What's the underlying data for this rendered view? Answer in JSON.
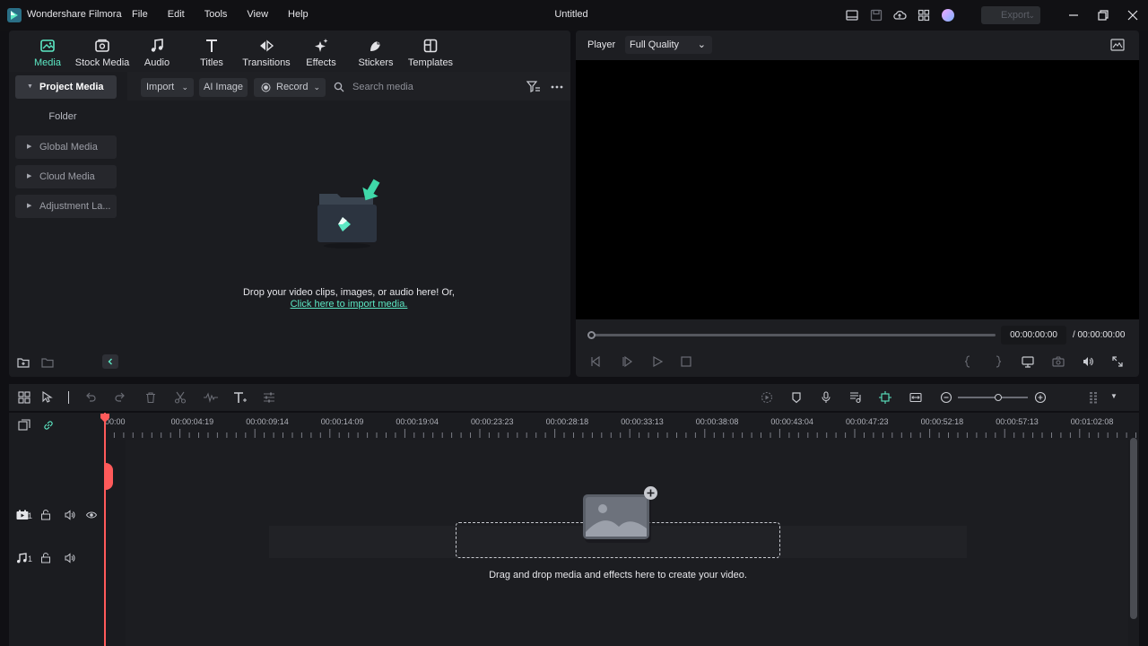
{
  "app": {
    "name": "Wondershare Filmora",
    "document_title": "Untitled",
    "menu": [
      "File",
      "Edit",
      "Tools",
      "View",
      "Help"
    ],
    "export_label": "Export",
    "accent_color": "#5ce8c4"
  },
  "media_tabs": [
    {
      "label": "Media",
      "icon": "media-icon",
      "active": true
    },
    {
      "label": "Stock Media",
      "icon": "stock-media-icon"
    },
    {
      "label": "Audio",
      "icon": "music-note-icon"
    },
    {
      "label": "Titles",
      "icon": "text-t-icon"
    },
    {
      "label": "Transitions",
      "icon": "transitions-icon"
    },
    {
      "label": "Effects",
      "icon": "effects-sparkle-icon"
    },
    {
      "label": "Stickers",
      "icon": "sticker-icon"
    },
    {
      "label": "Templates",
      "icon": "template-icon"
    }
  ],
  "sidebar": {
    "project_media": "Project Media",
    "folder": "Folder",
    "items": [
      "Global Media",
      "Cloud Media",
      "Adjustment La..."
    ]
  },
  "media_toolbar": {
    "import": "Import",
    "ai_image": "AI Image",
    "record": "Record",
    "search_placeholder": "Search media"
  },
  "media_empty": {
    "prompt": "Drop your video clips, images, or audio here! Or,",
    "link": "Click here to import media."
  },
  "player": {
    "label": "Player",
    "quality": "Full Quality",
    "current_time": "00:00:00:00",
    "total_time": "/ 00:00:00:00",
    "progress": 0
  },
  "timeline": {
    "ruler_labels": [
      "00:00",
      "00:00:04:19",
      "00:00:09:14",
      "00:00:14:09",
      "00:00:19:04",
      "00:00:23:23",
      "00:00:28:18",
      "00:00:33:13",
      "00:00:38:08",
      "00:00:43:04",
      "00:00:47:23",
      "00:00:52:18",
      "00:00:57:13",
      "00:01:02:08"
    ],
    "video_track_number": "1",
    "audio_track_number": "1",
    "drop_caption": "Drag and drop media and effects here to create your video."
  }
}
